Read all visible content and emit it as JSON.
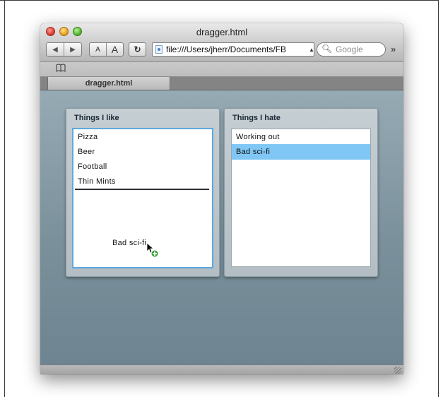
{
  "window": {
    "title": "dragger.html"
  },
  "toolbar": {
    "back_icon": "◀",
    "forward_icon": "▶",
    "font_smaller": "A",
    "font_larger": "A",
    "reload_icon": "↻",
    "url": "file:///Users/jherr/Documents/FB",
    "search_placeholder": "Google",
    "more_icon": "»"
  },
  "bookmarks": {
    "icon": "book-icon"
  },
  "tab": {
    "label": "dragger.html"
  },
  "lists": {
    "like": {
      "title": "Things I like",
      "items": [
        "Pizza",
        "Beer",
        "Football",
        "Thin Mints"
      ]
    },
    "hate": {
      "title": "Things I hate",
      "items": [
        "Working out",
        "Bad sci-fi"
      ],
      "selected": "Bad sci-fi"
    }
  },
  "drag": {
    "ghost_label": "Bad sci-fi"
  },
  "colors": {
    "selection": "#81c7f6",
    "focus_border": "#5fa8de",
    "background": "#7a909b"
  }
}
